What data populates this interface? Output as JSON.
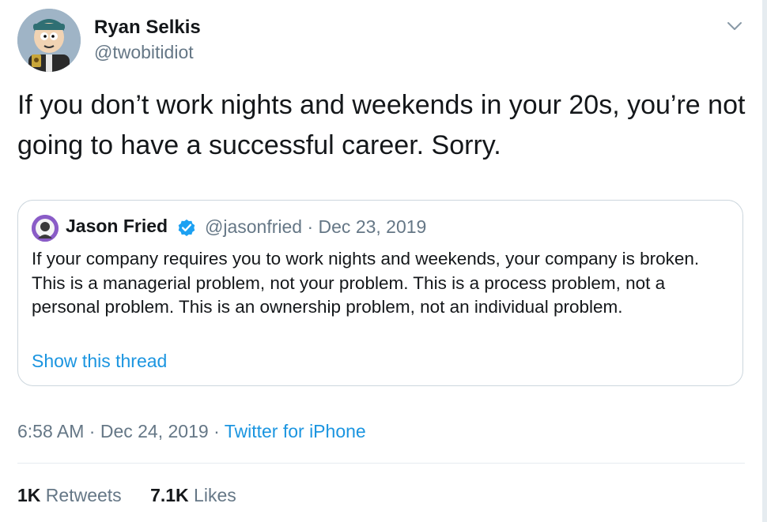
{
  "tweet": {
    "author_name": "Ryan Selkis",
    "author_handle": "@twobitidiot",
    "text": "If you don’t work nights and weekends in your 20s, you’re not going to have a successful career. Sorry.",
    "time": "6:58 AM",
    "date": "Dec 24, 2019",
    "source": "Twitter for iPhone",
    "retweets_count": "1K",
    "retweets_label": "Retweets",
    "likes_count": "7.1K",
    "likes_label": "Likes"
  },
  "quoted": {
    "author_name": "Jason Fried",
    "author_handle": "@jasonfried",
    "date": "Dec 23, 2019",
    "text": "If your company requires you to work nights and weekends, your company is broken. This is a managerial problem, not your problem. This is a process problem, not a personal problem. This is an ownership problem, not an individual problem.",
    "show_thread_label": "Show this thread"
  },
  "separator": "·",
  "icons": {
    "menu": "chevron-down-icon",
    "verified": "verified-badge-icon"
  },
  "colors": {
    "link": "#1b95e0",
    "verified": "#1da1f2",
    "secondary_text": "#657786",
    "primary_text": "#14171a",
    "border": "#ccd6dd"
  }
}
